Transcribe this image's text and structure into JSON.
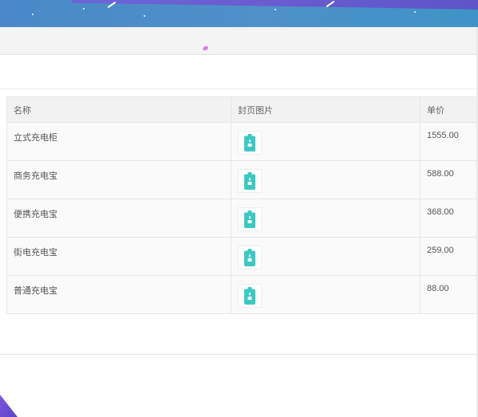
{
  "table": {
    "headers": {
      "name": "名称",
      "cover": "封页图片",
      "price": "单价"
    },
    "rows": [
      {
        "name": "立式充电柜",
        "cover_icon": "battery-icon",
        "price": "1555.00"
      },
      {
        "name": "商务充电宝",
        "cover_icon": "battery-icon",
        "price": "588.00"
      },
      {
        "name": "便携充电宝",
        "cover_icon": "battery-icon",
        "price": "368.00"
      },
      {
        "name": "街电充电宝",
        "cover_icon": "battery-icon",
        "price": "259.00"
      },
      {
        "name": "普通充电宝",
        "cover_icon": "battery-icon",
        "price": "88.00"
      }
    ]
  },
  "colors": {
    "banner_blue": "#4a8bc9",
    "banner_purple": "#6f57d1",
    "icon_teal": "#3dc8c3",
    "pink_accent": "#d77de6"
  }
}
